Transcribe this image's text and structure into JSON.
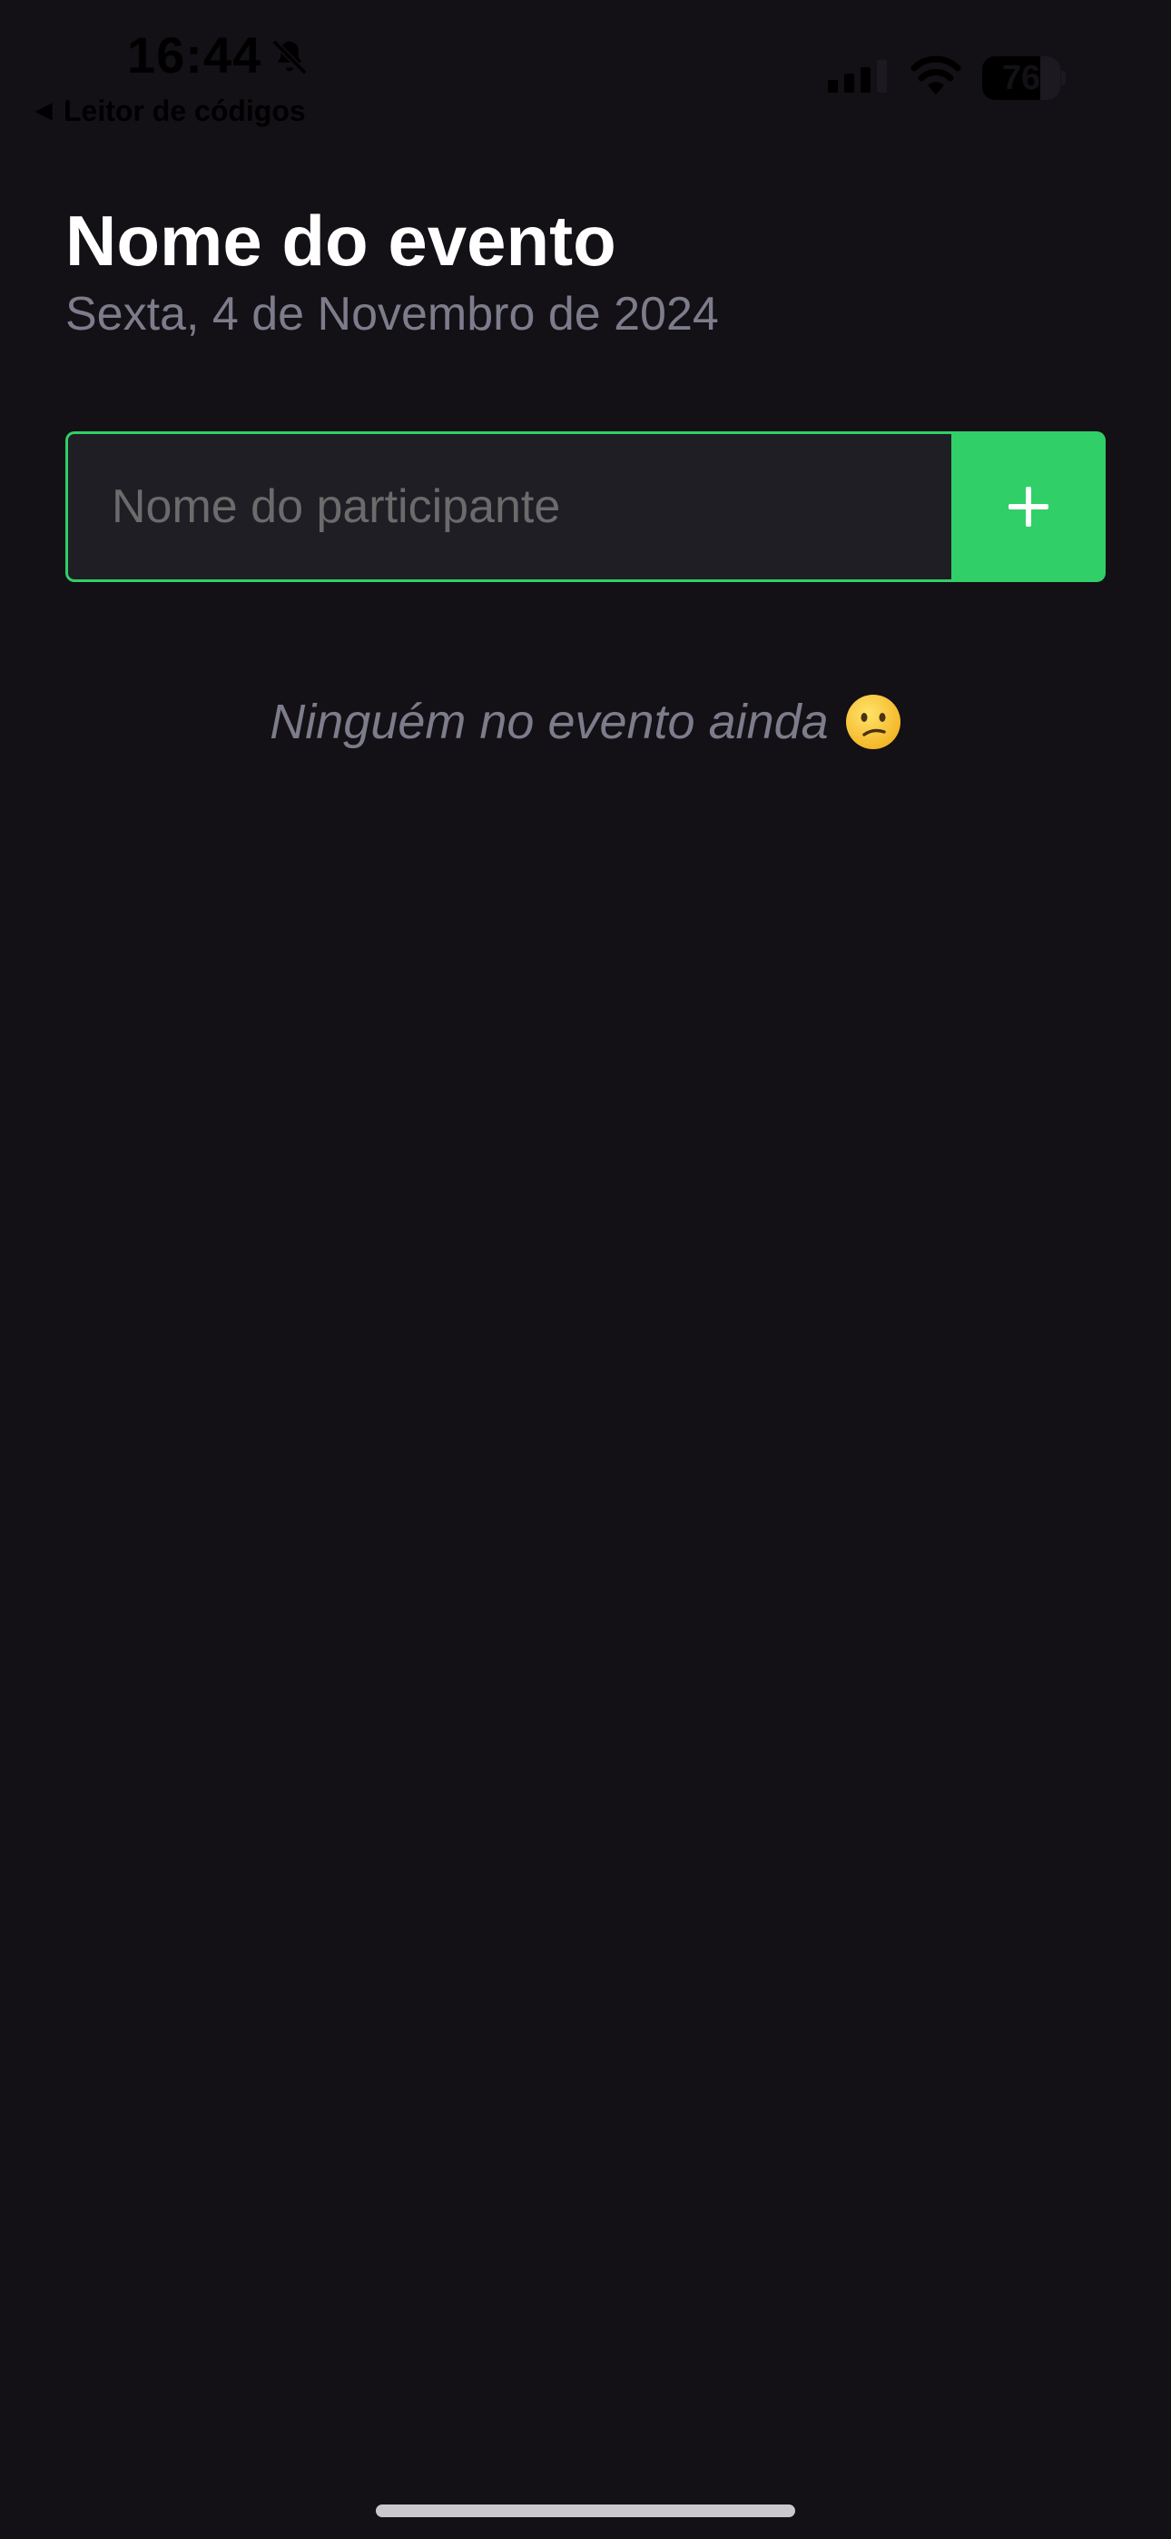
{
  "status_bar": {
    "time": "16:44",
    "back_label": "Leitor de códigos",
    "battery_level": "76"
  },
  "event": {
    "title": "Nome do evento",
    "date": "Sexta, 4 de Novembro de 2024"
  },
  "form": {
    "participant_placeholder": "Nome do participante",
    "participant_value": "",
    "add_icon": "plus-icon"
  },
  "empty_state": {
    "message": "Ninguém no evento ainda",
    "icon": "confused-face-icon"
  },
  "colors": {
    "background": "#131016",
    "accent": "#31CF67",
    "input_background": "#1F1E25",
    "muted_text": "#7C7C8A"
  }
}
